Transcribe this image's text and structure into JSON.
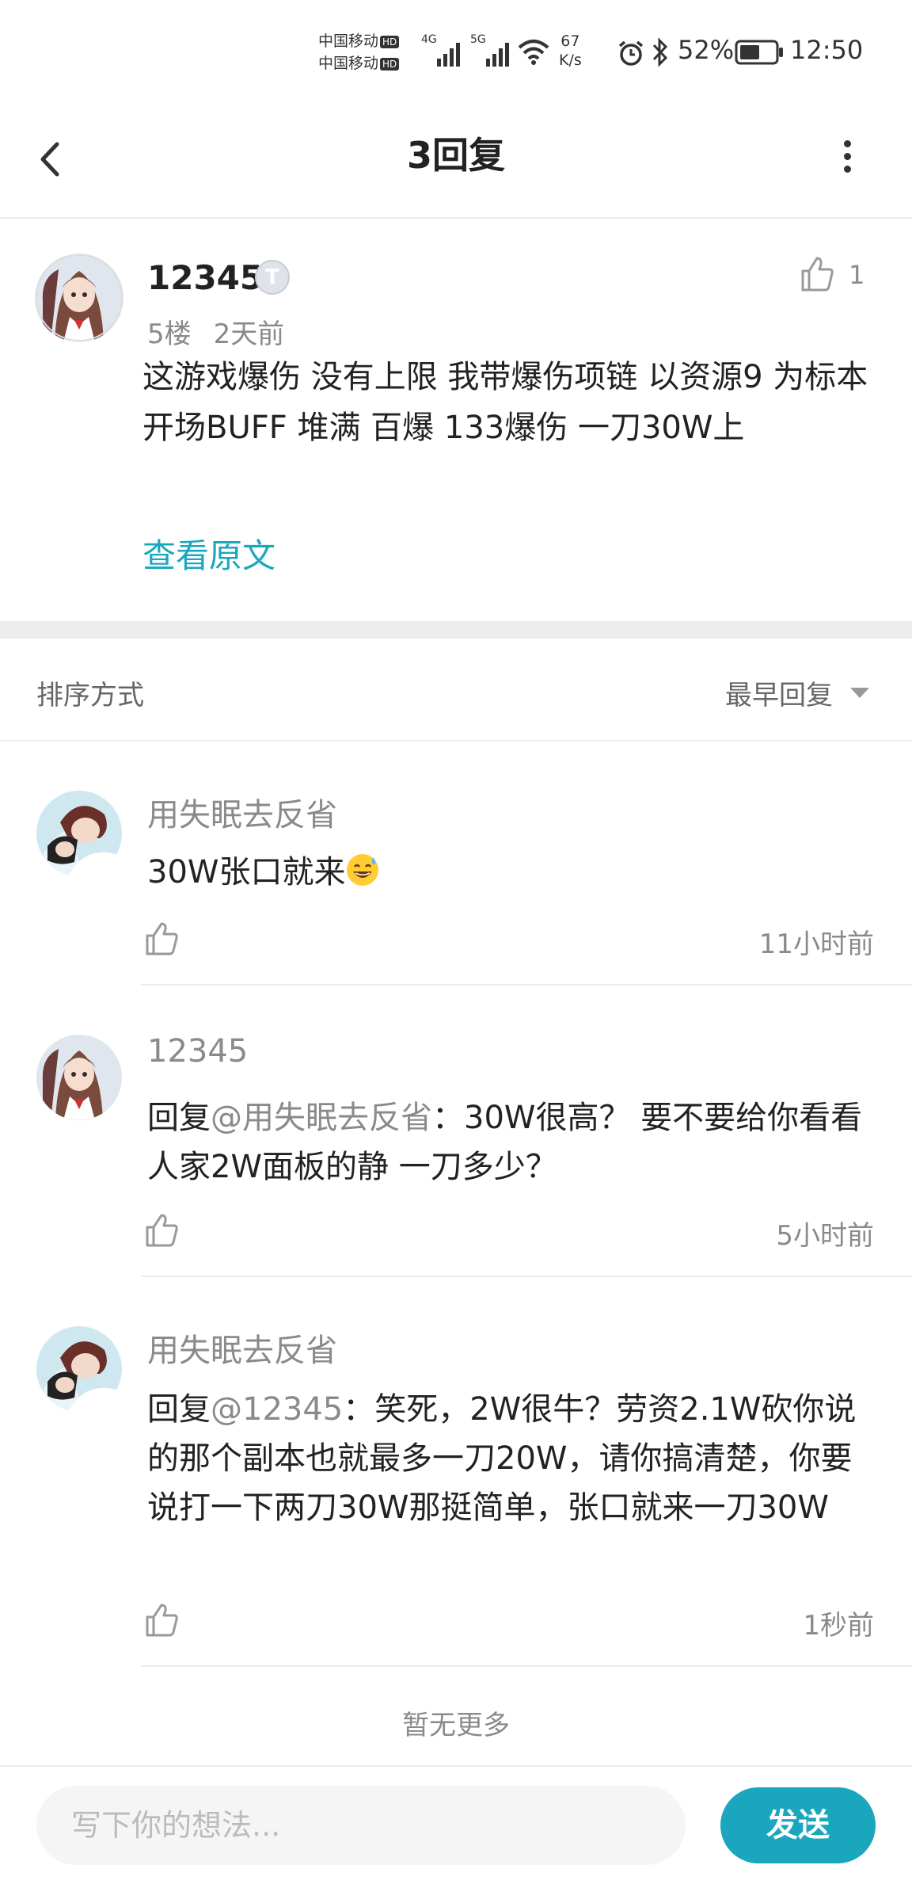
{
  "status_bar": {
    "carrier_1": "中国移动",
    "carrier_2": "中国移动",
    "hd": "HD",
    "net_4g": "4G",
    "net_5g": "5G",
    "speed_value": "67",
    "speed_unit": "K/s",
    "battery": "52%",
    "time": "12:50",
    "icons": [
      "signal-icon",
      "wifi-icon",
      "alarm-icon",
      "bluetooth-icon",
      "battery-icon"
    ]
  },
  "header": {
    "title": "3回复",
    "back_icon": "chevron-left-icon",
    "more_icon": "more-vertical-icon"
  },
  "post": {
    "username": "12345",
    "badge": "T",
    "floor": "5楼",
    "time": "2天前",
    "like_count": "1",
    "content": "这游戏爆伤  没有上限  我带爆伤项链  以资源9  为标本  开场BUFF 堆满  百爆  133爆伤 一刀30W上",
    "view_original": "查看原文"
  },
  "sort": {
    "label": "排序方式",
    "value": "最早回复"
  },
  "replies": [
    {
      "username": "用失眠去反省",
      "content": "30W张口就来",
      "emoji": "sweat-smile-emoji",
      "time": "11小时前"
    },
    {
      "username": "12345",
      "reply_prefix": "回复",
      "mention": "@用失眠去反省",
      "content": "：30W很高？  要不要给你看看人家2W面板的静 一刀多少？",
      "time": "5小时前"
    },
    {
      "username": "用失眠去反省",
      "reply_prefix": "回复",
      "mention": "@12345",
      "content": "：笑死，2W很牛？劳资2.1W砍你说的那个副本也就最多一刀20W，请你搞清楚，你要说打一下两刀30W那挺简单，张口就来一刀30W",
      "time": "1秒前"
    }
  ],
  "no_more": "暂无更多",
  "composer": {
    "placeholder": "写下你的想法...",
    "send_label": "发送"
  },
  "colors": {
    "accent": "#1aa7bd",
    "secondary_text": "#8a8a8a",
    "divider": "#ececec"
  }
}
